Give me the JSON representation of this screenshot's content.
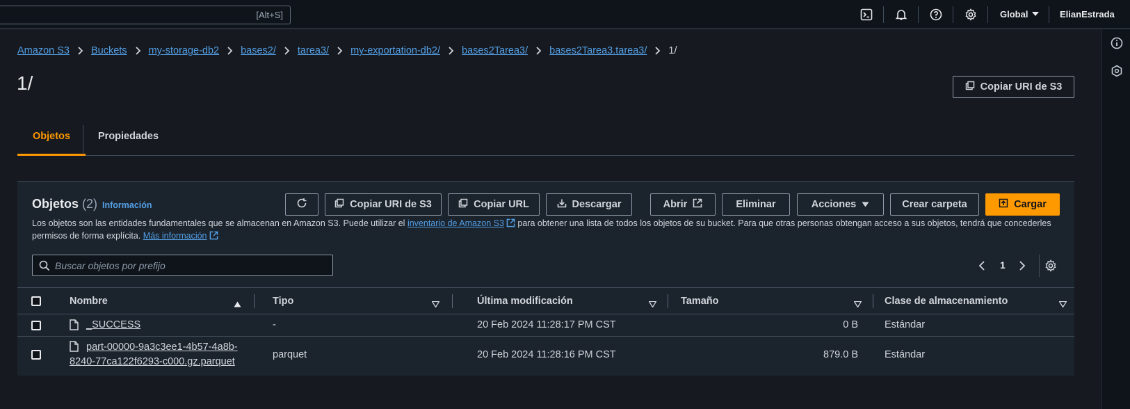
{
  "topbar": {
    "search_shortcut": "[Alt+S]",
    "region": "Global",
    "user": "ElianEstrada"
  },
  "breadcrumbs": [
    {
      "label": "Amazon S3"
    },
    {
      "label": "Buckets"
    },
    {
      "label": "my-storage-db2"
    },
    {
      "label": "bases2/"
    },
    {
      "label": "tarea3/"
    },
    {
      "label": "my-exportation-db2/"
    },
    {
      "label": "bases2Tarea3/"
    },
    {
      "label": "bases2Tarea3.tarea3/"
    }
  ],
  "breadcrumb_current": "1/",
  "page": {
    "title": "1/",
    "copy_uri_label": "Copiar URI de S3"
  },
  "tabs": [
    {
      "label": "Objetos",
      "active": true
    },
    {
      "label": "Propiedades",
      "active": false
    }
  ],
  "objects_panel": {
    "title": "Objetos",
    "count": "(2)",
    "info_link": "Información",
    "description_1": "Los objetos son las entidades fundamentales que se almacenan en Amazon S3. Puede utilizar el ",
    "inventory_link": "inventario de Amazon S3",
    "description_2": " para obtener una lista de todos los objetos de su bucket. Para que otras personas obtengan acceso a sus objetos, tendrá que concederles permisos de forma explícita. ",
    "more_info_link": "Más información",
    "actions": {
      "copy_uri": "Copiar URI de S3",
      "copy_url": "Copiar URL",
      "download": "Descargar",
      "open": "Abrir",
      "delete": "Eliminar",
      "actions": "Acciones",
      "create_folder": "Crear carpeta",
      "upload": "Cargar"
    },
    "search_placeholder": "Buscar objetos por prefijo",
    "page_number": "1"
  },
  "table": {
    "columns": [
      "Nombre",
      "Tipo",
      "Última modificación",
      "Tamaño",
      "Clase de almacenamiento"
    ],
    "rows": [
      {
        "name": "_SUCCESS",
        "name_line2": "",
        "type": "-",
        "modified": "20 Feb 2024 11:28:17 PM CST",
        "size": "0 B",
        "storage": "Estándar"
      },
      {
        "name": "part-00000-9a3c3ee1-4b57-4a8b-",
        "name_line2": "8240-77ca122f6293-c000.gz.parquet",
        "type": "parquet",
        "modified": "20 Feb 2024 11:28:16 PM CST",
        "size": "879.0 B",
        "storage": "Estándar"
      }
    ]
  },
  "colors": {
    "accent": "#ff9900",
    "link": "#539fe5",
    "background": "#16191f",
    "panel": "#1b232d"
  },
  "icons": [
    "terminal-icon",
    "bell-icon",
    "help-icon",
    "gear-icon",
    "info-icon",
    "hexagon-icon",
    "refresh-icon",
    "copy-icon",
    "download-icon",
    "external-link-icon",
    "upload-icon",
    "search-icon",
    "chevron-left-icon",
    "chevron-right-icon",
    "file-icon"
  ]
}
